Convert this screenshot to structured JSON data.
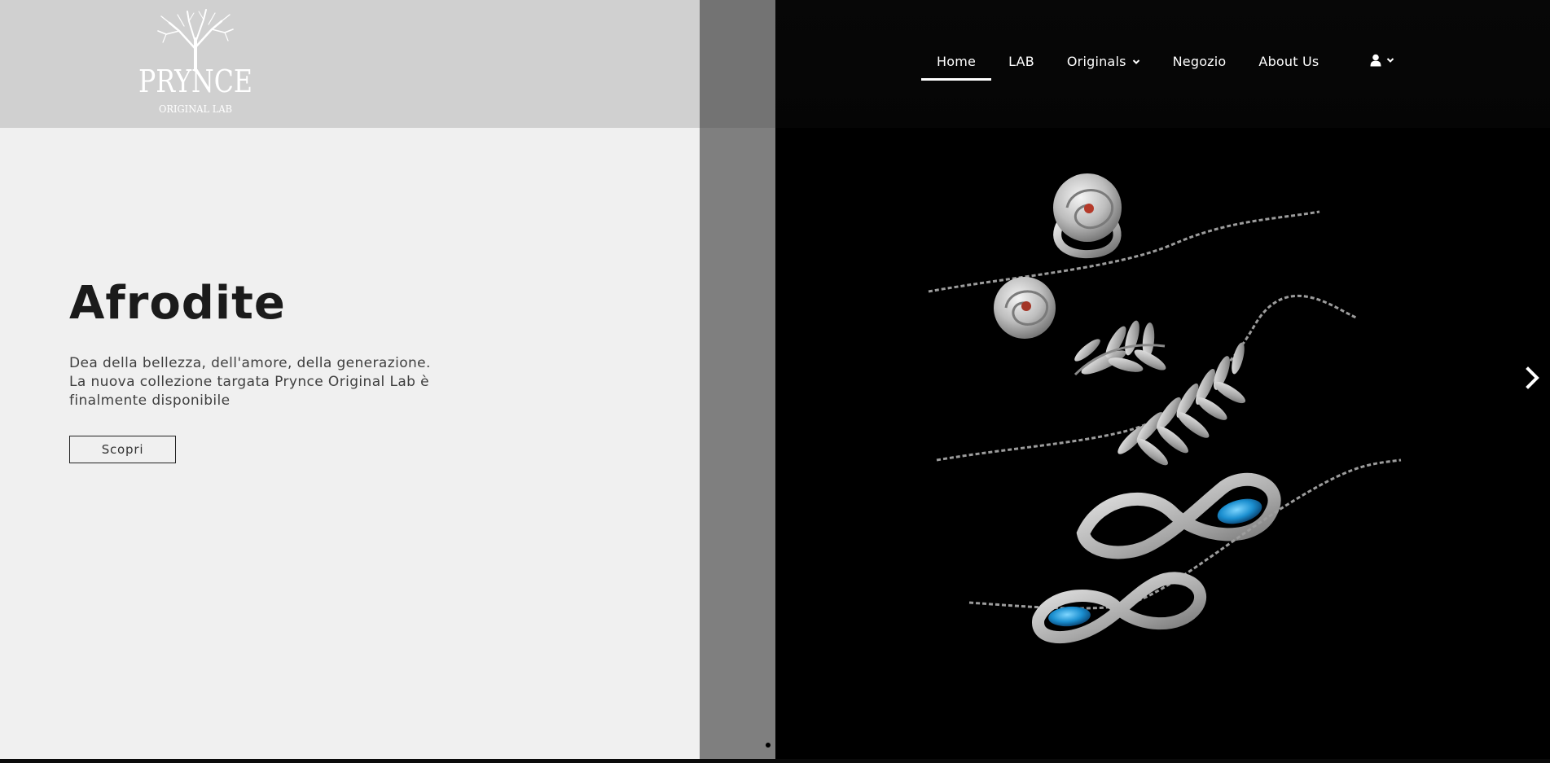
{
  "brand": {
    "logo_top": "PRYNCE",
    "logo_bottom": "ORIGINAL LAB",
    "logo_icon": "tree-logo-icon"
  },
  "nav": {
    "items": [
      {
        "label": "Home",
        "active": true
      },
      {
        "label": "LAB"
      },
      {
        "label": "Originals",
        "has_dropdown": true
      },
      {
        "label": "Negozio"
      },
      {
        "label": "About Us"
      }
    ],
    "account_icon": "user-icon",
    "account_dropdown_icon": "chevron-down-icon"
  },
  "hero": {
    "title": "Afrodite",
    "description_lines": [
      "Dea della bellezza, dell'amore, della generazione.",
      "La nuova collezione targata Prynce Original Lab è",
      "finalmente disponibile"
    ],
    "cta_label": "Scopri",
    "image_subject": "silver jewelry collection on black background"
  },
  "slider": {
    "next_icon": "chevron-right-icon",
    "current_slide": 1
  },
  "colors": {
    "left_panel": "#f0f0f0",
    "header_left": "#d0d0d0",
    "strip": "#7f7f7f",
    "dark": "#000000",
    "text": "#1b1b1b"
  }
}
